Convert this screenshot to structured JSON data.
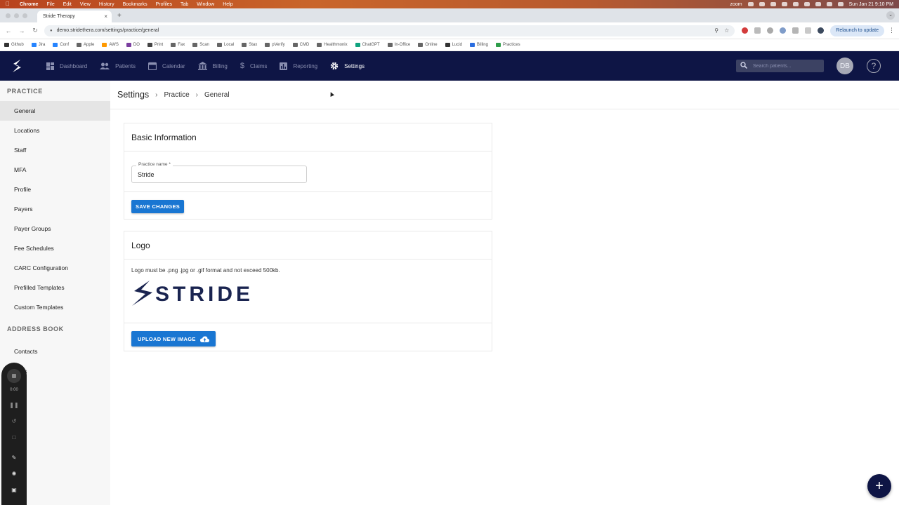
{
  "mac_menubar": {
    "app": "Chrome",
    "menus": [
      "File",
      "Edit",
      "View",
      "History",
      "Bookmarks",
      "Profiles",
      "Tab",
      "Window",
      "Help"
    ],
    "tray_label": "zoom",
    "clock": "Sun Jan 21  9:10 PM"
  },
  "browser": {
    "tab_title": "Stride Therapy",
    "tab_close": "×",
    "new_tab": "+",
    "url": "demo.stridethera.com/settings/practice/general",
    "relaunch_label": "Relaunch to update",
    "bookmarks": [
      {
        "label": "Github",
        "color": "#333333"
      },
      {
        "label": "Jira",
        "color": "#2684ff"
      },
      {
        "label": "Conf",
        "color": "#2684ff"
      },
      {
        "label": "Apple",
        "color": "#666666"
      },
      {
        "label": "AWS",
        "color": "#ff9900"
      },
      {
        "label": "DO",
        "color": "#7b3fa0"
      },
      {
        "label": "Print",
        "color": "#444444"
      },
      {
        "label": "Fax",
        "color": "#666666"
      },
      {
        "label": "Scan",
        "color": "#666666"
      },
      {
        "label": "Local",
        "color": "#666666"
      },
      {
        "label": "Stax",
        "color": "#666666"
      },
      {
        "label": "pVerify",
        "color": "#666666"
      },
      {
        "label": "CMD",
        "color": "#666666"
      },
      {
        "label": "Healthmonix",
        "color": "#666666"
      },
      {
        "label": "ChatGPT",
        "color": "#10a37f"
      },
      {
        "label": "In-Office",
        "color": "#666666"
      },
      {
        "label": "Online",
        "color": "#666666"
      },
      {
        "label": "Lucid",
        "color": "#333333"
      },
      {
        "label": "Billing",
        "color": "#2a6de0"
      },
      {
        "label": "Practices",
        "color": "#2e9d4a"
      }
    ]
  },
  "topnav": {
    "items": [
      {
        "label": "Dashboard",
        "icon": "dashboard-icon",
        "active": false
      },
      {
        "label": "Patients",
        "icon": "patients-icon",
        "active": false
      },
      {
        "label": "Calendar",
        "icon": "calendar-icon",
        "active": false
      },
      {
        "label": "Billing",
        "icon": "billing-icon",
        "active": false
      },
      {
        "label": "Claims",
        "icon": "dollar-icon",
        "active": false
      },
      {
        "label": "Reporting",
        "icon": "chart-icon",
        "active": false
      },
      {
        "label": "Settings",
        "icon": "gear-icon",
        "active": true
      }
    ],
    "search_placeholder": "Search patients...",
    "avatar_initials": "DB",
    "help_glyph": "?"
  },
  "sidebar": {
    "practice_header": "PRACTICE",
    "practice_items": [
      "General",
      "Locations",
      "Staff",
      "MFA",
      "Profile",
      "Payers",
      "Payer Groups",
      "Fee Schedules",
      "CARC Configuration",
      "Prefilled Templates",
      "Custom Templates"
    ],
    "active_item": "General",
    "address_header": "ADDRESS BOOK",
    "address_items": [
      "Contacts",
      "iders"
    ]
  },
  "recorder": {
    "time": "0:00"
  },
  "breadcrumb": {
    "title": "Settings",
    "items": [
      "Practice",
      "General"
    ]
  },
  "basic_info": {
    "heading": "Basic Information",
    "field_label": "Practice name *",
    "field_value": "Stride",
    "save_label": "SAVE CHANGES"
  },
  "logo_section": {
    "heading": "Logo",
    "note": "Logo must be .png .jpg or .gif format and not exceed 500kb.",
    "logo_text": "STRIDE",
    "upload_label": "UPLOAD NEW IMAGE"
  },
  "fab": {
    "glyph": "+"
  },
  "colors": {
    "nav_bg": "#0e1545",
    "primary": "#1976d2",
    "logo_navy": "#1a2450"
  }
}
